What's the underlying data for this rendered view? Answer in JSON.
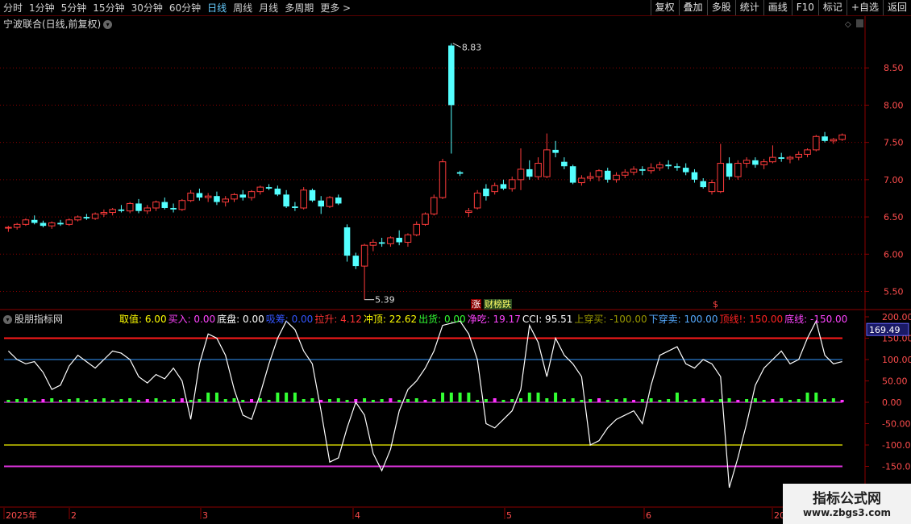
{
  "toolbar": {
    "periods": [
      "分时",
      "1分钟",
      "5分钟",
      "15分钟",
      "30分钟",
      "60分钟",
      "日线",
      "周线",
      "月线",
      "多周期",
      "更多"
    ],
    "active_period": "日线",
    "more_arrow": ">",
    "buttons": [
      "复权",
      "叠加",
      "多股",
      "统计",
      "画线",
      "F10",
      "标记",
      "+自选",
      "返回"
    ]
  },
  "main_chart": {
    "title": "宁波联合(日线,前复权)",
    "high_label": "8.83",
    "low_label": "5.39",
    "price_axis": [
      "8.50",
      "8.00",
      "7.50",
      "7.00",
      "6.50",
      "6.00",
      "5.50"
    ],
    "badges": {
      "zhang": "涨",
      "caibang": "财榜跌",
      "dollar": "$"
    }
  },
  "indicator": {
    "title": "股朋指标网",
    "current_value": "169.49",
    "values": [
      {
        "label": "取值:",
        "value": "6.00",
        "color": "#ffff00"
      },
      {
        "label": "买入:",
        "value": "0.00",
        "color": "#ff44ff"
      },
      {
        "label": "底盘:",
        "value": "0.00",
        "color": "#ffffff"
      },
      {
        "label": "吸筹:",
        "value": "0.00",
        "color": "#3355ff"
      },
      {
        "label": "拉升:",
        "value": "4.12",
        "color": "#ff3333"
      },
      {
        "label": "冲顶:",
        "value": "22.62",
        "color": "#ffff00"
      },
      {
        "label": "出货:",
        "value": "0.00",
        "color": "#33ff33"
      },
      {
        "label": "净吃:",
        "value": "19.17",
        "color": "#ff44ff"
      },
      {
        "label": "CCI:",
        "value": "95.51",
        "color": "#ffffff"
      },
      {
        "label": "上穿买:",
        "value": "-100.00",
        "color": "#999900"
      },
      {
        "label": "下穿卖:",
        "value": "100.00",
        "color": "#55aaff"
      },
      {
        "label": "顶线!:",
        "value": "150.00",
        "color": "#ff2222"
      },
      {
        "label": "底线:",
        "value": "-150.00",
        "color": "#ff44ff"
      }
    ],
    "axis": [
      "200.00",
      "150.00",
      "100.00",
      "50.00",
      "0.00",
      "-50.00",
      "-100.00",
      "-150.00"
    ]
  },
  "time_axis": [
    "2025年",
    "2",
    "3",
    "4",
    "5",
    "6",
    "20"
  ],
  "watermark": {
    "line1": "指标公式网",
    "line2": "www.zbgs3.com"
  },
  "colors": {
    "up": "#ff3b3b",
    "down": "#54ffff",
    "grid": "#8b0000"
  },
  "chart_data": {
    "type": "candlestick",
    "candles": [
      [
        6.35,
        6.38,
        6.3,
        6.36
      ],
      [
        6.36,
        6.42,
        6.33,
        6.4
      ],
      [
        6.4,
        6.48,
        6.38,
        6.46
      ],
      [
        6.46,
        6.52,
        6.4,
        6.42
      ],
      [
        6.42,
        6.45,
        6.36,
        6.38
      ],
      [
        6.38,
        6.44,
        6.34,
        6.42
      ],
      [
        6.42,
        6.46,
        6.38,
        6.4
      ],
      [
        6.4,
        6.48,
        6.38,
        6.46
      ],
      [
        6.46,
        6.52,
        6.44,
        6.5
      ],
      [
        6.5,
        6.54,
        6.46,
        6.48
      ],
      [
        6.48,
        6.56,
        6.46,
        6.54
      ],
      [
        6.54,
        6.6,
        6.5,
        6.56
      ],
      [
        6.56,
        6.62,
        6.52,
        6.6
      ],
      [
        6.6,
        6.66,
        6.56,
        6.58
      ],
      [
        6.58,
        6.7,
        6.55,
        6.68
      ],
      [
        6.68,
        6.74,
        6.55,
        6.58
      ],
      [
        6.58,
        6.66,
        6.54,
        6.62
      ],
      [
        6.62,
        6.72,
        6.58,
        6.7
      ],
      [
        6.7,
        6.76,
        6.6,
        6.62
      ],
      [
        6.62,
        6.68,
        6.56,
        6.6
      ],
      [
        6.6,
        6.74,
        6.58,
        6.72
      ],
      [
        6.72,
        6.86,
        6.7,
        6.82
      ],
      [
        6.82,
        6.88,
        6.72,
        6.76
      ],
      [
        6.76,
        6.82,
        6.7,
        6.78
      ],
      [
        6.78,
        6.84,
        6.66,
        6.7
      ],
      [
        6.7,
        6.78,
        6.64,
        6.74
      ],
      [
        6.74,
        6.82,
        6.7,
        6.8
      ],
      [
        6.8,
        6.86,
        6.72,
        6.76
      ],
      [
        6.76,
        6.86,
        6.72,
        6.84
      ],
      [
        6.84,
        6.92,
        6.8,
        6.9
      ],
      [
        6.9,
        6.94,
        6.86,
        6.88
      ],
      [
        6.88,
        6.92,
        6.78,
        6.8
      ],
      [
        6.8,
        6.86,
        6.62,
        6.64
      ],
      [
        6.64,
        6.7,
        6.58,
        6.62
      ],
      [
        6.62,
        6.9,
        6.6,
        6.86
      ],
      [
        6.86,
        6.88,
        6.7,
        6.72
      ],
      [
        6.72,
        6.78,
        6.54,
        6.64
      ],
      [
        6.64,
        6.78,
        6.62,
        6.76
      ],
      [
        6.76,
        6.8,
        6.66,
        6.68
      ],
      [
        6.36,
        6.4,
        5.9,
        5.98
      ],
      [
        5.98,
        6.02,
        5.8,
        5.84
      ],
      [
        5.84,
        6.14,
        5.39,
        6.12
      ],
      [
        6.12,
        6.2,
        6.04,
        6.16
      ],
      [
        6.16,
        6.22,
        6.1,
        6.14
      ],
      [
        6.14,
        6.24,
        6.1,
        6.22
      ],
      [
        6.22,
        6.32,
        6.12,
        6.16
      ],
      [
        6.16,
        6.28,
        6.1,
        6.26
      ],
      [
        6.26,
        6.44,
        6.24,
        6.4
      ],
      [
        6.4,
        6.56,
        6.38,
        6.54
      ],
      [
        6.54,
        6.8,
        6.52,
        6.76
      ],
      [
        6.76,
        7.28,
        6.74,
        7.24
      ],
      [
        8.8,
        8.83,
        7.35,
        8.0
      ],
      [
        7.1,
        7.12,
        7.05,
        7.08
      ],
      [
        6.56,
        6.62,
        6.5,
        6.58
      ],
      [
        6.62,
        6.86,
        6.6,
        6.82
      ],
      [
        6.88,
        6.94,
        6.72,
        6.78
      ],
      [
        6.84,
        6.96,
        6.8,
        6.92
      ],
      [
        6.94,
        7.0,
        6.86,
        6.88
      ],
      [
        6.88,
        7.04,
        6.84,
        7.0
      ],
      [
        7.0,
        7.42,
        6.86,
        7.14
      ],
      [
        7.14,
        7.26,
        7.0,
        7.04
      ],
      [
        7.04,
        7.3,
        7.0,
        7.22
      ],
      [
        7.04,
        7.62,
        7.02,
        7.4
      ],
      [
        7.4,
        7.52,
        7.3,
        7.36
      ],
      [
        7.24,
        7.3,
        7.14,
        7.18
      ],
      [
        7.18,
        7.2,
        6.94,
        6.96
      ],
      [
        6.96,
        7.06,
        6.92,
        7.02
      ],
      [
        7.02,
        7.1,
        6.98,
        7.04
      ],
      [
        7.04,
        7.14,
        6.98,
        7.12
      ],
      [
        7.12,
        7.16,
        6.96,
        7.0
      ],
      [
        7.0,
        7.1,
        6.96,
        7.06
      ],
      [
        7.06,
        7.14,
        7.02,
        7.1
      ],
      [
        7.1,
        7.18,
        7.06,
        7.14
      ],
      [
        7.14,
        7.18,
        7.06,
        7.12
      ],
      [
        7.12,
        7.22,
        7.08,
        7.16
      ],
      [
        7.16,
        7.24,
        7.12,
        7.2
      ],
      [
        7.2,
        7.26,
        7.14,
        7.18
      ],
      [
        7.18,
        7.22,
        7.12,
        7.16
      ],
      [
        7.16,
        7.22,
        7.06,
        7.1
      ],
      [
        7.1,
        7.14,
        6.96,
        7.0
      ],
      [
        6.98,
        7.02,
        6.88,
        6.9
      ],
      [
        6.84,
        7.0,
        6.8,
        6.96
      ],
      [
        6.84,
        7.48,
        6.82,
        7.22
      ],
      [
        7.22,
        7.3,
        7.0,
        7.04
      ],
      [
        7.04,
        7.26,
        7.0,
        7.22
      ],
      [
        7.22,
        7.3,
        7.16,
        7.26
      ],
      [
        7.26,
        7.3,
        7.16,
        7.2
      ],
      [
        7.2,
        7.28,
        7.14,
        7.24
      ],
      [
        7.24,
        7.46,
        7.22,
        7.3
      ],
      [
        7.3,
        7.36,
        7.24,
        7.28
      ],
      [
        7.28,
        7.32,
        7.22,
        7.3
      ],
      [
        7.3,
        7.38,
        7.26,
        7.34
      ],
      [
        7.34,
        7.42,
        7.3,
        7.4
      ],
      [
        7.4,
        7.6,
        7.38,
        7.58
      ],
      [
        7.58,
        7.64,
        7.5,
        7.52
      ],
      [
        7.52,
        7.56,
        7.48,
        7.54
      ],
      [
        7.54,
        7.62,
        7.52,
        7.6
      ]
    ],
    "cci": [
      120,
      100,
      90,
      95,
      70,
      30,
      40,
      85,
      110,
      95,
      80,
      100,
      120,
      115,
      100,
      60,
      45,
      65,
      55,
      80,
      50,
      -40,
      90,
      160,
      150,
      110,
      30,
      -30,
      -40,
      20,
      90,
      150,
      190,
      170,
      120,
      90,
      -20,
      -140,
      -130,
      -60,
      0,
      -30,
      -120,
      -160,
      -110,
      -20,
      30,
      50,
      80,
      120,
      180,
      185,
      190,
      160,
      100,
      -50,
      -60,
      -40,
      -20,
      30,
      180,
      140,
      60,
      150,
      110,
      90,
      60,
      -100,
      -90,
      -60,
      -40,
      -30,
      -20,
      -50,
      40,
      110,
      120,
      130,
      90,
      80,
      100,
      90,
      60,
      -200,
      -130,
      -50,
      40,
      80,
      100,
      120,
      90,
      100,
      150,
      190,
      110,
      90,
      95
    ],
    "ylim_price": [
      5.3,
      9.0
    ],
    "ylim_indicator": [
      -200,
      200
    ]
  }
}
